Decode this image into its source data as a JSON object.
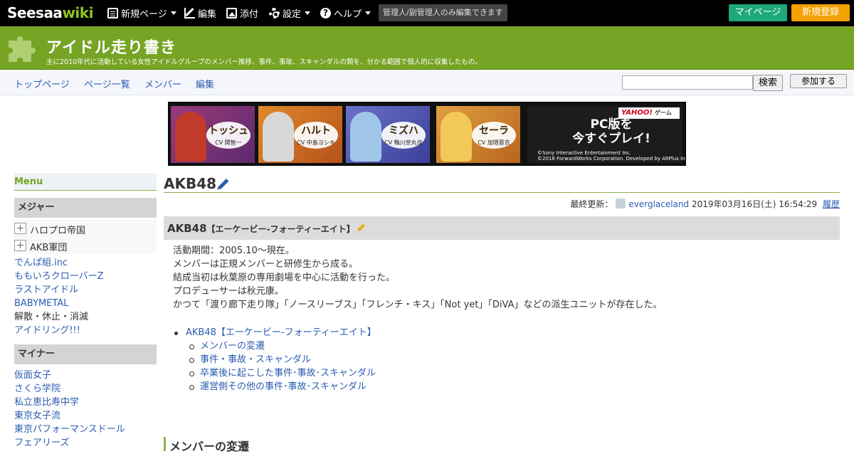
{
  "topbar": {
    "logo_part1": "Seesaa",
    "logo_part2": "wiki",
    "menu": [
      {
        "label": "新規ページ",
        "icon": "document-icon"
      },
      {
        "label": "編集",
        "icon": "edit-icon"
      },
      {
        "label": "添付",
        "icon": "image-icon"
      },
      {
        "label": "設定",
        "icon": "gear-icon"
      },
      {
        "label": "ヘルプ",
        "icon": "help-icon"
      }
    ],
    "notice": "管理人/副管理人のみ編集できます",
    "mypage": "マイページ",
    "register": "新規登録"
  },
  "header": {
    "title": "アイドル走り書き",
    "description": "主に2010年代に活動している女性アイドルグループのメンバー推移、事件、事故、スキャンダルの類を、分かる範囲で個人的に収集したもの。"
  },
  "nav": {
    "links": [
      "トップページ",
      "ページ一覧",
      "メンバー",
      "編集"
    ],
    "search_button": "検索",
    "search_value": "",
    "join_button": "参加する"
  },
  "banner": {
    "cards": [
      {
        "name": "トッシュ",
        "cv": "CV 関智一"
      },
      {
        "name": "ハルト",
        "cv": "CV 中島ヨシキ"
      },
      {
        "name": "ミズハ",
        "cv": "CV 鴨川奈丸佳"
      },
      {
        "name": "セーラ",
        "cv": "CV 加隈亜衣"
      }
    ],
    "yahoo": "YAHOO!",
    "yahoo_sub": "ゲーム",
    "cta_line1": "PC版を",
    "cta_line2": "今すぐプレイ!",
    "copyright1": "©Sony Interactive Entertainment Inc.",
    "copyright2": "©2018 ForwardWorks Corporation. Developed by AltPlus Inc."
  },
  "sidebar": {
    "menu_heading": "Menu",
    "major_heading": "メジャー",
    "tree_items": [
      "ハロプロ帝国",
      "AKB軍団"
    ],
    "major_links": [
      "でんぱ組.inc",
      "ももいろクローバーZ",
      "ラストアイドル",
      "BABYMETAL"
    ],
    "disbanded": "解散・休止・消滅",
    "aidoring": "アイドリング!!!",
    "minor_heading": "マイナー",
    "minor_links": [
      "仮面女子",
      "さくら学院",
      "私立恵比寿中学",
      "東京女子流",
      "東京パフォーマンスドール",
      "フェアリーズ"
    ]
  },
  "main": {
    "page_title": "AKB48",
    "updated_label": "最終更新：",
    "updated_user": "everglaceland",
    "updated_date": "2019年03月16日(土) 16:54:29",
    "history": "履歴",
    "h2_title": "AKB48",
    "h2_sub": "【エーケービー-フォーティーエイト】",
    "body": [
      "活動期間：2005.10～現在。",
      "メンバーは正規メンバーと研修生から成る。",
      "結成当初は秋葉原の専用劇場を中心に活動を行った。",
      "プロデューサーは秋元康。",
      "かつて「渡り廊下走り隊」「ノースリーブス」「フレンチ・キス」「Not yet」「DiVA」などの派生ユニットが存在した。"
    ],
    "toc_top": "AKB48【エーケービー-フォーティーエイト】",
    "toc_sub": [
      "メンバーの変遷",
      "事件・事故・スキャンダル",
      "卒業後に起こした事件･事故･スキャンダル",
      "運営側その他の事件･事故･スキャンダル"
    ],
    "h3_title": "メンバーの変遷"
  },
  "colors": {
    "header_green": "#76a424",
    "mypage_green": "#1fa87a",
    "register_orange": "#f5a100",
    "link_blue": "#2a5db0"
  }
}
